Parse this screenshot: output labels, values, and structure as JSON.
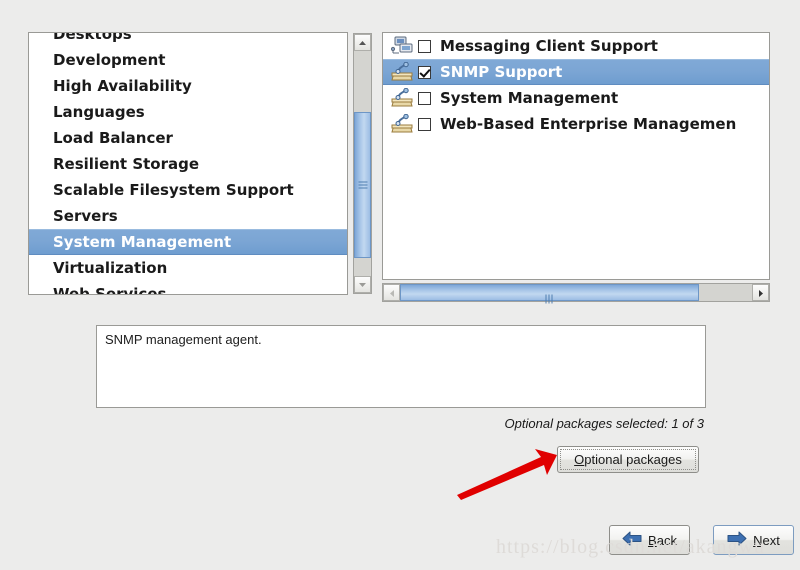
{
  "group_list": {
    "name": "package-group-list",
    "items": [
      {
        "label": "Desktops",
        "selected": false,
        "clipped": true
      },
      {
        "label": "Development",
        "selected": false
      },
      {
        "label": "High Availability",
        "selected": false
      },
      {
        "label": "Languages",
        "selected": false
      },
      {
        "label": "Load Balancer",
        "selected": false
      },
      {
        "label": "Resilient Storage",
        "selected": false
      },
      {
        "label": "Scalable Filesystem Support",
        "selected": false
      },
      {
        "label": "Servers",
        "selected": false
      },
      {
        "label": "System Management",
        "selected": true
      },
      {
        "label": "Virtualization",
        "selected": false
      },
      {
        "label": "Web Services",
        "selected": false
      }
    ],
    "scrollbar": {
      "orientation": "vertical",
      "up_icon": "chevron-up-icon",
      "down_icon": "chevron-down-icon"
    }
  },
  "package_list": {
    "name": "package-subgroup-list",
    "items": [
      {
        "label": "Messaging Client Support",
        "checked": false,
        "selected": false,
        "icon": "computer-network-icon"
      },
      {
        "label": "SNMP Support",
        "checked": true,
        "selected": true,
        "icon": "package-tools-icon"
      },
      {
        "label": "System Management",
        "checked": false,
        "selected": false,
        "icon": "package-tools-icon"
      },
      {
        "label": "Web-Based Enterprise Managemen",
        "checked": false,
        "selected": false,
        "icon": "package-tools-icon"
      }
    ],
    "scrollbar": {
      "orientation": "horizontal",
      "left_icon": "chevron-left-icon",
      "right_icon": "chevron-right-icon",
      "left_disabled": true
    }
  },
  "description": {
    "text": "SNMP management agent."
  },
  "status": {
    "text": "Optional packages selected: 1 of 3"
  },
  "buttons": {
    "optional": {
      "mnemonic": "O",
      "rest": "ptional packages"
    },
    "back": {
      "mnemonic": "B",
      "rest": "ack",
      "icon": "arrow-left-icon"
    },
    "next": {
      "mnemonic": "N",
      "rest": "ext",
      "icon": "arrow-right-icon"
    }
  },
  "annotation": {
    "arrow_color": "#e00000",
    "name": "red-pointer-arrow"
  },
  "watermark": {
    "text": "https://blog.csdn.net/akangwu"
  },
  "colors": {
    "background": "#ececeb",
    "selection": "#7ba5d4",
    "selection_text": "#ffffff",
    "scroll_thumb": "#a8c6e8",
    "panel_border": "#9a9a96"
  }
}
